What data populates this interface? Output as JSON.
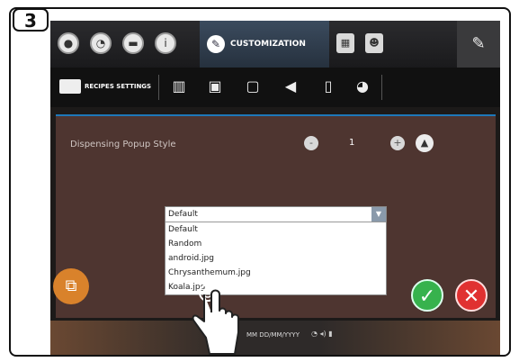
{
  "step_number": "3",
  "topbar": {
    "tabs": [
      {
        "icon": "drop-icon"
      },
      {
        "icon": "clock-icon"
      },
      {
        "icon": "cup-icon"
      },
      {
        "icon": "info-icon"
      }
    ],
    "active_tab": {
      "label": "CUSTOMIZATION",
      "icon": "pencil-icon"
    },
    "extra_icons": [
      "screen-icon",
      "user-icon"
    ],
    "settings_icon": "wrench-icon"
  },
  "subbar": {
    "recipes_label": "RECIPES SETTINGS",
    "items": [
      "book-icon",
      "image-icon",
      "screen-icon",
      "speaker-icon",
      "bottle-icon",
      "palette-icon"
    ]
  },
  "setting": {
    "label": "Dispensing Popup Style",
    "minus": "-",
    "plus": "+",
    "value": "1"
  },
  "dropdown": {
    "selected": "Default",
    "options": [
      "Default",
      "Random",
      "android.jpg",
      "Chrysanthemum.jpg",
      "Koala.jpg"
    ]
  },
  "footer": {
    "date_format": "MM DD/MM/YYYY"
  },
  "colors": {
    "accent": "#1e78b9",
    "panel": "#4e3530",
    "confirm": "#37b24d",
    "cancel": "#e03131"
  }
}
